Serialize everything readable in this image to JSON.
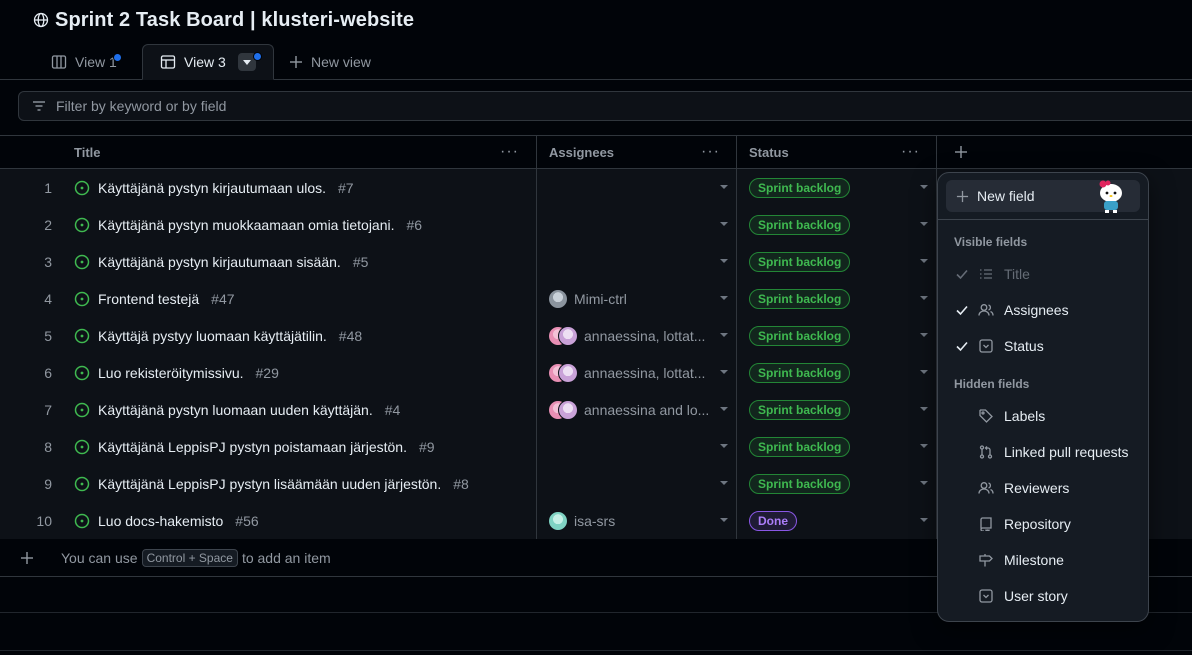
{
  "header": {
    "title": "Sprint 2 Task Board | klusteri-website"
  },
  "tabs": [
    {
      "label": "View 1"
    },
    {
      "label": "View 3"
    },
    {
      "label": "New view"
    }
  ],
  "filter": {
    "placeholder": "Filter by keyword or by field"
  },
  "columns": {
    "title": "Title",
    "assignees": "Assignees",
    "status": "Status"
  },
  "rows": [
    {
      "num": "1",
      "title": "Käyttäjänä pystyn kirjautumaan ulos.",
      "issue": "#7",
      "assignees": "",
      "status": "Sprint backlog"
    },
    {
      "num": "2",
      "title": "Käyttäjänä pystyn muokkaamaan omia tietojani.",
      "issue": "#6",
      "assignees": "",
      "status": "Sprint backlog"
    },
    {
      "num": "3",
      "title": "Käyttäjänä pystyn kirjautumaan sisään.",
      "issue": "#5",
      "assignees": "",
      "status": "Sprint backlog"
    },
    {
      "num": "4",
      "title": "Frontend testejä",
      "issue": "#47",
      "assignees": "Mimi-ctrl",
      "status": "Sprint backlog"
    },
    {
      "num": "5",
      "title": "Käyttäjä pystyy luomaan käyttäjätilin.",
      "issue": "#48",
      "assignees": "annaessina, lottat...",
      "status": "Sprint backlog"
    },
    {
      "num": "6",
      "title": "Luo rekisteröitymissivu.",
      "issue": "#29",
      "assignees": "annaessina, lottat...",
      "status": "Sprint backlog"
    },
    {
      "num": "7",
      "title": "Käyttäjänä pystyn luomaan uuden käyttäjän.",
      "issue": "#4",
      "assignees": "annaessina and lo...",
      "status": "Sprint backlog"
    },
    {
      "num": "8",
      "title": "Käyttäjänä LeppisPJ pystyn poistamaan järjestön.",
      "issue": "#9",
      "assignees": "",
      "status": "Sprint backlog"
    },
    {
      "num": "9",
      "title": "Käyttäjänä LeppisPJ pystyn lisäämään uuden järjestön.",
      "issue": "#8",
      "assignees": "",
      "status": "Sprint backlog"
    },
    {
      "num": "10",
      "title": "Luo docs-hakemisto",
      "issue": "#56",
      "assignees": "isa-srs",
      "status": "Done"
    }
  ],
  "add_item": {
    "prefix": "You can use",
    "shortcut": "Control + Space",
    "suffix": "to add an item"
  },
  "menu": {
    "new_field": "New field",
    "visible_header": "Visible fields",
    "visible": [
      "Title",
      "Assignees",
      "Status"
    ],
    "hidden_header": "Hidden fields",
    "hidden": [
      "Labels",
      "Linked pull requests",
      "Reviewers",
      "Repository",
      "Milestone",
      "User story"
    ]
  },
  "colors": {
    "green_badge": "#3fb950",
    "purple_badge": "#ab7df8",
    "accent_dot": "#1f6feb"
  }
}
